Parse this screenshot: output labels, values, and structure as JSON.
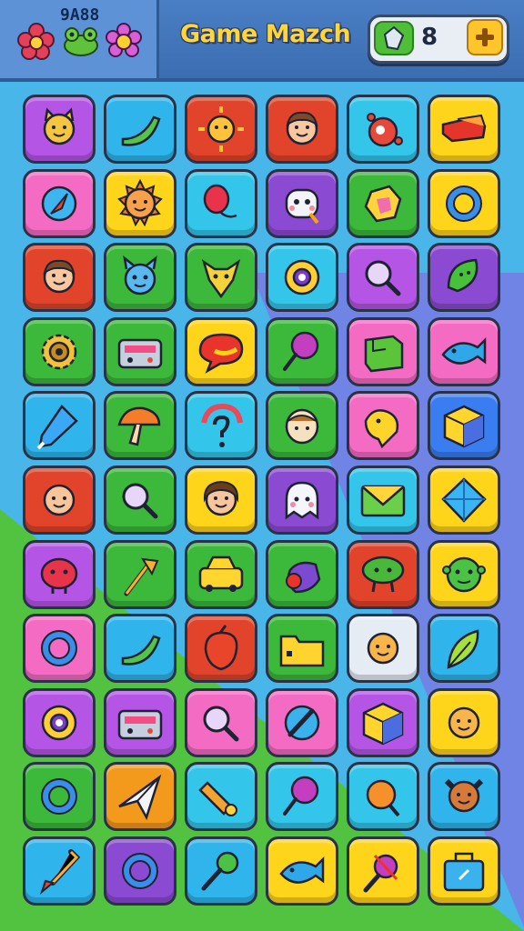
{
  "header": {
    "logo_code": "9A88",
    "title": "Game Mazch",
    "gem_count": "8",
    "left_icons": [
      "flower-icon",
      "frog-icon",
      "flower-icon"
    ]
  },
  "colors": {
    "purple": "#b455e6",
    "blue": "#2fb5ec",
    "red": "#e1442a",
    "yellow": "#ffd51c",
    "pink": "#f46bc3",
    "green": "#3cb83a",
    "orange": "#f39a1c",
    "cyan": "#33c6ea",
    "violet": "#8a4ad1",
    "royal": "#3a7df0",
    "white": "#e6ecf4"
  },
  "board": [
    [
      {
        "c": "purple",
        "icon": "cat-face-icon"
      },
      {
        "c": "blue",
        "icon": "banana-icon"
      },
      {
        "c": "red",
        "icon": "sun-icon"
      },
      {
        "c": "red",
        "icon": "boy-face-icon"
      },
      {
        "c": "cyan",
        "icon": "ornament-icon"
      },
      {
        "c": "yellow",
        "icon": "ribbon-icon"
      }
    ],
    [
      {
        "c": "pink",
        "icon": "compass-icon"
      },
      {
        "c": "yellow",
        "icon": "sun-face-icon"
      },
      {
        "c": "cyan",
        "icon": "balloon-icon"
      },
      {
        "c": "violet",
        "icon": "robot-icon"
      },
      {
        "c": "green",
        "icon": "gem-icon"
      },
      {
        "c": "yellow",
        "icon": "ring-icon"
      }
    ],
    [
      {
        "c": "red",
        "icon": "boy-face-icon"
      },
      {
        "c": "green",
        "icon": "monster-icon"
      },
      {
        "c": "green",
        "icon": "fox-icon"
      },
      {
        "c": "cyan",
        "icon": "donut-icon"
      },
      {
        "c": "purple",
        "icon": "magnifier-icon"
      },
      {
        "c": "violet",
        "icon": "leaf-face-icon"
      }
    ],
    [
      {
        "c": "green",
        "icon": "gear-icon"
      },
      {
        "c": "green",
        "icon": "radio-icon"
      },
      {
        "c": "yellow",
        "icon": "chat-bubble-icon"
      },
      {
        "c": "green",
        "icon": "lollipop-icon"
      },
      {
        "c": "pink",
        "icon": "box-icon"
      },
      {
        "c": "pink",
        "icon": "fish-icon"
      }
    ],
    [
      {
        "c": "blue",
        "icon": "glue-icon"
      },
      {
        "c": "green",
        "icon": "mushroom-icon"
      },
      {
        "c": "cyan",
        "icon": "question-icon"
      },
      {
        "c": "green",
        "icon": "egg-face-icon"
      },
      {
        "c": "pink",
        "icon": "duck-icon"
      },
      {
        "c": "royal",
        "icon": "cube-icon"
      }
    ],
    [
      {
        "c": "red",
        "icon": "baby-face-icon"
      },
      {
        "c": "green",
        "icon": "magnifier-icon"
      },
      {
        "c": "yellow",
        "icon": "girl-face-icon"
      },
      {
        "c": "violet",
        "icon": "ghost-icon"
      },
      {
        "c": "cyan",
        "icon": "envelope-icon"
      },
      {
        "c": "yellow",
        "icon": "diamond-icon"
      }
    ],
    [
      {
        "c": "purple",
        "icon": "blob-icon"
      },
      {
        "c": "green",
        "icon": "wand-icon"
      },
      {
        "c": "green",
        "icon": "car-icon"
      },
      {
        "c": "green",
        "icon": "bird-icon"
      },
      {
        "c": "red",
        "icon": "tree-icon"
      },
      {
        "c": "yellow",
        "icon": "alien-icon"
      }
    ],
    [
      {
        "c": "pink",
        "icon": "ring-icon"
      },
      {
        "c": "blue",
        "icon": "banana-icon"
      },
      {
        "c": "red",
        "icon": "acorn-icon"
      },
      {
        "c": "green",
        "icon": "folder-icon"
      },
      {
        "c": "white",
        "icon": "smiley-icon"
      },
      {
        "c": "blue",
        "icon": "leaf-icon"
      }
    ],
    [
      {
        "c": "purple",
        "icon": "donut-icon"
      },
      {
        "c": "purple",
        "icon": "radio-icon"
      },
      {
        "c": "pink",
        "icon": "magnifier-icon"
      },
      {
        "c": "pink",
        "icon": "rocket-icon"
      },
      {
        "c": "purple",
        "icon": "cube-icon"
      },
      {
        "c": "yellow",
        "icon": "smiley-icon"
      }
    ],
    [
      {
        "c": "green",
        "icon": "ring-icon"
      },
      {
        "c": "orange",
        "icon": "paper-plane-icon"
      },
      {
        "c": "cyan",
        "icon": "candle-icon"
      },
      {
        "c": "cyan",
        "icon": "lollipop-icon"
      },
      {
        "c": "cyan",
        "icon": "orange-icon"
      },
      {
        "c": "blue",
        "icon": "dog-face-icon"
      }
    ],
    [
      {
        "c": "blue",
        "icon": "brush-icon"
      },
      {
        "c": "violet",
        "icon": "ring-icon"
      },
      {
        "c": "blue",
        "icon": "rattle-icon"
      },
      {
        "c": "yellow",
        "icon": "fish-icon"
      },
      {
        "c": "yellow",
        "icon": "spray-icon"
      },
      {
        "c": "yellow",
        "icon": "bag-icon"
      }
    ]
  ]
}
